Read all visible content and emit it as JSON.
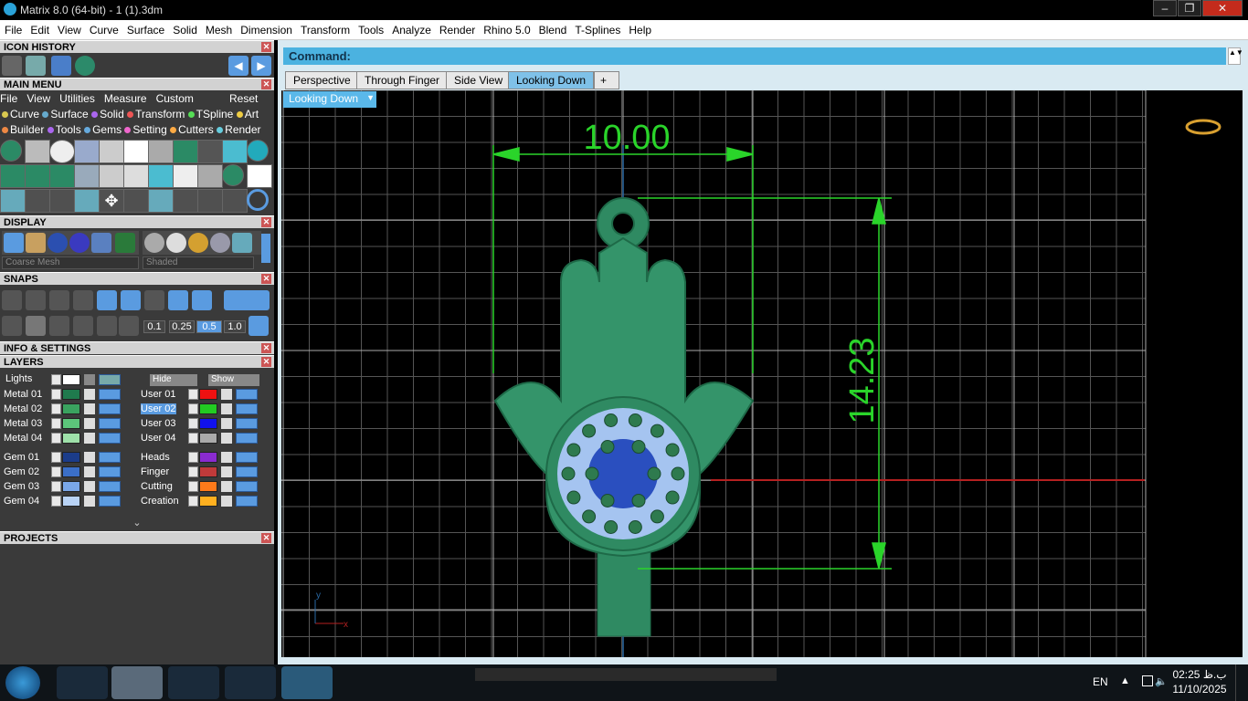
{
  "window": {
    "title": "Matrix 8.0 (64-bit) - 1 (1).3dm"
  },
  "menu": [
    "File",
    "Edit",
    "View",
    "Curve",
    "Surface",
    "Solid",
    "Mesh",
    "Dimension",
    "Transform",
    "Tools",
    "Analyze",
    "Render",
    "Rhino 5.0",
    "Blend",
    "T-Splines",
    "Help"
  ],
  "left": {
    "icon_history": "ICON HISTORY",
    "main_menu": "MAIN MENU",
    "main_menu_row": [
      "File",
      "View",
      "Utilities",
      "Measure",
      "Custom"
    ],
    "reset": "Reset",
    "cat_row1": [
      "Curve",
      "Surface",
      "Solid",
      "Transform",
      "TSpline",
      "Art"
    ],
    "cat_row2": [
      "Builder",
      "Tools",
      "Gems",
      "Setting",
      "Cutters",
      "Render"
    ],
    "display": "DISPLAY",
    "mesh_option": "Coarse Mesh",
    "shade_option": "Shaded",
    "snaps": "SNAPS",
    "snap_values": [
      "0.1",
      "0.25",
      "0.5",
      "1.0"
    ],
    "info": "INFO & SETTINGS",
    "layers": "LAYERS",
    "lights": "Lights",
    "hide": "Hide",
    "show": "Show",
    "projects": "PROJECTS"
  },
  "layers_left": [
    {
      "name": "Metal 01",
      "color": "#1f7a4d"
    },
    {
      "name": "Metal 02",
      "color": "#3aa35f"
    },
    {
      "name": "Metal 03",
      "color": "#5cc57a"
    },
    {
      "name": "Metal 04",
      "color": "#9ee0a9"
    },
    {
      "name": "Gem 01",
      "color": "#1b3c8a"
    },
    {
      "name": "Gem 02",
      "color": "#3b6fc8"
    },
    {
      "name": "Gem 03",
      "color": "#7aa7e8"
    },
    {
      "name": "Gem 04",
      "color": "#b9d3f5"
    }
  ],
  "layers_right": [
    {
      "name": "User 01",
      "color": "#e11"
    },
    {
      "name": "User 02",
      "color": "#2c2"
    },
    {
      "name": "User 03",
      "color": "#11e"
    },
    {
      "name": "User 04",
      "color": "#aaa"
    },
    {
      "name": "Heads",
      "color": "#8a2bd0"
    },
    {
      "name": "Finger",
      "color": "#c03a3a"
    },
    {
      "name": "Cutting",
      "color": "#ff7a1a"
    },
    {
      "name": "Creation",
      "color": "#ffb020"
    }
  ],
  "command": {
    "label": "Command:"
  },
  "tabs": [
    "Perspective",
    "Through Finger",
    "Side View",
    "Looking Down"
  ],
  "view_selector": "Looking Down",
  "dimensions": {
    "width": "10.00",
    "height": "14.23"
  },
  "axis": {
    "x": "x",
    "y": "y"
  },
  "taskbar": {
    "lang": "EN",
    "time": "02:25 ب.ظ",
    "date": "11/10/2025"
  }
}
